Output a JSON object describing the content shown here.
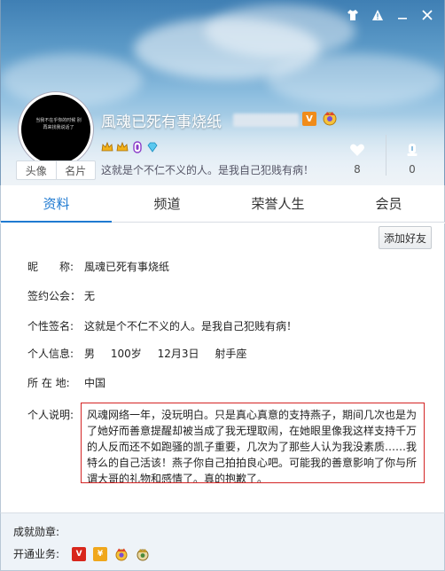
{
  "window": {
    "buttons": [
      "shirt-icon",
      "alert-icon",
      "minimize-icon",
      "close-icon"
    ]
  },
  "profile": {
    "avatar_tabs": [
      "头像",
      "名片"
    ],
    "avatar_text": "当我不在乎你的时候 别再来找我说话了",
    "nickname": "風魂已死有事烧纸",
    "signature": "这就是个不仁不义的人。是我自己犯贱有病！",
    "likes": "8",
    "honor": "0",
    "badge_v": "V"
  },
  "tabs": [
    "资料",
    "频道",
    "荣誉人生",
    "会员"
  ],
  "add_friend": "添加好友",
  "info": {
    "nickname_label": "昵　　称:",
    "nickname_value": "風魂已死有事烧纸",
    "guild_label": "签约公会：",
    "guild_value": "无",
    "sign_label": "个性签名:",
    "sign_value": "这就是个不仁不义的人。是我自己犯贱有病！",
    "personal_label": "个人信息:",
    "gender": "男",
    "age": "100岁",
    "birthday": "12月3日",
    "zodiac": "射手座",
    "location_label": "所 在 地:",
    "location_value": "中国",
    "desc_label": "个人说明:",
    "desc_value": "风魂网络一年，没玩明白。只是真心真意的支持燕子，期间几次也是为了她好而善意提醒却被当成了我无理取闹，在她眼里像我这样支持千万的人反而还不如跑骚的凯子重要，几次为了那些人认为我没素质……我特么的自己活该！燕子你自己拍拍良心吧。可能我的善意影响了你与所谓大哥的礼物和感情了。真的抱歉了。"
  },
  "footer": {
    "medals_label": "成就勋章:",
    "services_label": "开通业务:",
    "services": [
      "vip-badge-icon",
      "yellow-diamond-icon",
      "noble-badge-icon",
      "crown-badge-icon"
    ]
  },
  "colors": {
    "accent": "#1f7ad1",
    "highlight_border": "#d42424"
  }
}
